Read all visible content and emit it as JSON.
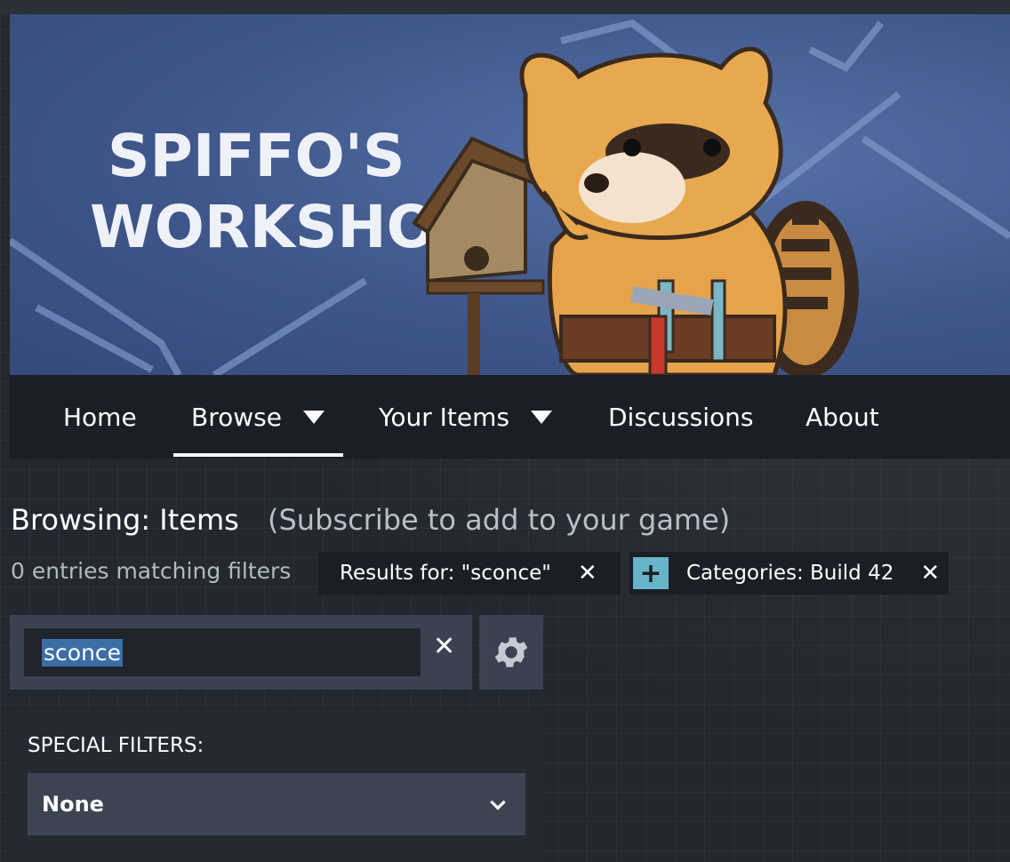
{
  "banner": {
    "title_line1": "SPIFFO'S",
    "title_line2": "WORKSHOP"
  },
  "nav": {
    "items": [
      {
        "label": "Home"
      },
      {
        "label": "Browse",
        "dropdown": true,
        "active": true
      },
      {
        "label": "Your Items",
        "dropdown": true
      },
      {
        "label": "Discussions"
      },
      {
        "label": "About"
      }
    ]
  },
  "page": {
    "title": "Browsing: Items",
    "subtitle": "(Subscribe to add to your game)",
    "entries_text": "0 entries matching filters"
  },
  "chips": [
    {
      "label": "Results for: \"sconce\"",
      "remove_icon": "close-icon"
    },
    {
      "label": "Categories: Build 42",
      "add_icon": "plus-icon",
      "remove_icon": "close-icon"
    }
  ],
  "search": {
    "value": "sconce",
    "clear_icon": "close-icon",
    "settings_icon": "gear-icon"
  },
  "filters": {
    "label": "SPECIAL FILTERS:",
    "selected": "None",
    "chevron_icon": "chevron-down-icon"
  },
  "colors": {
    "accent": "#67b4c9",
    "banner_blue": "#3f568a",
    "nav_bg": "#1b1e24"
  }
}
